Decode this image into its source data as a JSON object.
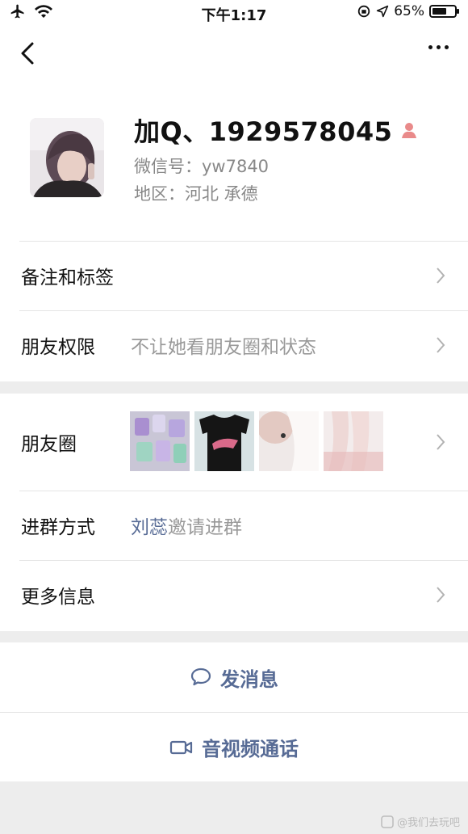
{
  "status_bar": {
    "time": "下午1:17",
    "battery": "65%",
    "battery_level": 0.65
  },
  "profile": {
    "name": "加Q、1929578045",
    "wechat_id": "微信号：yw7840",
    "region": "地区：河北 承德",
    "gender_icon": "female-person-icon"
  },
  "rows": {
    "remark": {
      "label": "备注和标签"
    },
    "privacy": {
      "label": "朋友权限",
      "value": "不让她看朋友圈和状态"
    },
    "moments": {
      "label": "朋友圈"
    },
    "join_method": {
      "label": "进群方式",
      "inviter": "刘蕊",
      "suffix": "邀请进群"
    },
    "more_info": {
      "label": "更多信息"
    }
  },
  "actions": {
    "message": {
      "label": "发消息",
      "icon": "chat-bubble-icon"
    },
    "video_call": {
      "label": "音视频通话",
      "icon": "video-camera-icon"
    }
  },
  "watermark": "@我们去玩吧",
  "colors": {
    "link": "#576b95",
    "background": "#ededed",
    "gender": "#e98a8a"
  }
}
